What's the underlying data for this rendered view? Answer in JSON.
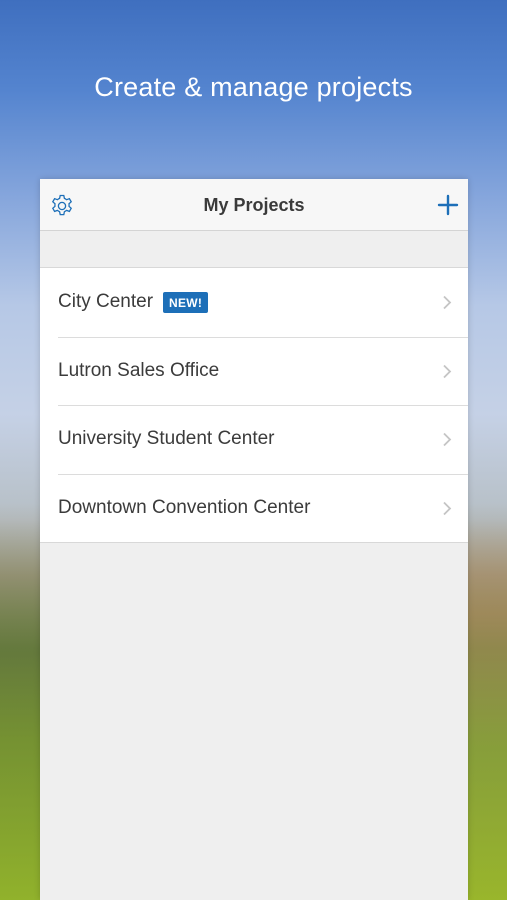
{
  "headline": "Create & manage projects",
  "navbar": {
    "title": "My Projects",
    "settings_icon": "gear-icon",
    "add_icon": "plus-icon"
  },
  "projects": [
    {
      "name": "City Center",
      "badge": "NEW!"
    },
    {
      "name": "Lutron Sales Office"
    },
    {
      "name": "University Student Center"
    },
    {
      "name": "Downtown Convention Center"
    }
  ],
  "colors": {
    "accent": "#1d6fb8",
    "badge_bg": "#1d6fb8",
    "panel_bg": "#efefef",
    "row_text": "#3b3b3b"
  }
}
